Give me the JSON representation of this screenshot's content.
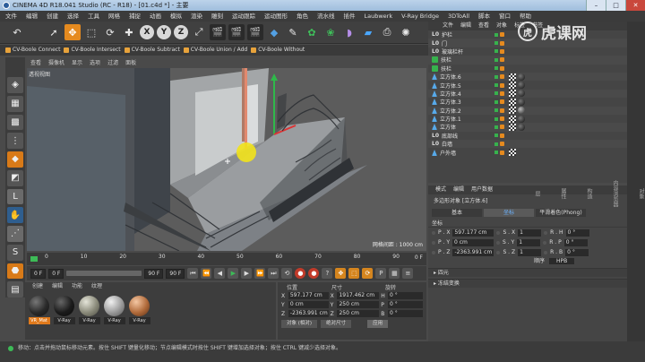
{
  "window": {
    "title": "CINEMA 4D R18.041 Studio (RC - R18) - [01.c4d *] - 主要",
    "min": "–",
    "max": "□",
    "close": "✕"
  },
  "menubar": [
    "文件",
    "编辑",
    "创建",
    "选择",
    "工具",
    "网格",
    "捕捉",
    "动画",
    "模拟",
    "渲染",
    "雕刻",
    "运动跟踪",
    "运动图形",
    "角色",
    "流水线",
    "插件",
    "Laubwerk",
    "V-Ray Bridge",
    "3DToAll",
    "脚本",
    "窗口",
    "帮助"
  ],
  "plugins": [
    "CV-Boole Connect",
    "CV-Boole Intersect",
    "CV-Boole Subtract",
    "CV-Boole Union / Add",
    "CV-Boole Without"
  ],
  "viewport": {
    "menu": [
      "查看",
      "摄像机",
      "显示",
      "选项",
      "过滤",
      "面板"
    ],
    "label": "透视视图",
    "grid_spacing": "网格间距 : 1000 cm"
  },
  "timeline": {
    "ticks": [
      "0",
      "10",
      "20",
      "30",
      "40",
      "50",
      "60",
      "70",
      "80",
      "90"
    ],
    "end": "0 F"
  },
  "frames": {
    "current": "0 F",
    "min": "0 F",
    "max": "90 F",
    "end": "90 F"
  },
  "materials": {
    "menu": [
      "创建",
      "编辑",
      "功能",
      "纹理"
    ],
    "items": [
      {
        "name": "VR_Mat",
        "color": "#2a2a2a"
      },
      {
        "name": "V-Ray",
        "color": "#1b1b1b"
      },
      {
        "name": "V-Ray",
        "color": "#8a8a7a"
      },
      {
        "name": "V-Ray",
        "color": "#9a9a9a"
      },
      {
        "name": "V-Ray",
        "color": "#b06a3a"
      }
    ]
  },
  "coords": {
    "headers": [
      "位置",
      "尺寸",
      "旋转"
    ],
    "rows": [
      {
        "axis": "X",
        "pos": "597.177 cm",
        "size": "1917.462 cm",
        "rot_axis": "H",
        "rot": "0 °"
      },
      {
        "axis": "Y",
        "pos": "0 cm",
        "size": "250 cm",
        "rot_axis": "P",
        "rot": "0 °"
      },
      {
        "axis": "Z",
        "pos": "-2363.991 cm",
        "size": "250 cm",
        "rot_axis": "B",
        "rot": "0 °"
      }
    ],
    "mode": "对象 (相对)",
    "size_mode": "绝对尺寸",
    "apply": "应用"
  },
  "objects": {
    "menu": [
      "文件",
      "编辑",
      "查看",
      "对象",
      "标签",
      "书签"
    ],
    "items": [
      {
        "name": "护栏",
        "icon": "l0"
      },
      {
        "name": "门",
        "icon": "l0"
      },
      {
        "name": "玻璃栏杆",
        "icon": "l0"
      },
      {
        "name": "扶栏",
        "icon": "green"
      },
      {
        "name": "扶栏",
        "icon": "green"
      },
      {
        "name": "立方体.6",
        "icon": "tri"
      },
      {
        "name": "立方体.5",
        "icon": "tri"
      },
      {
        "name": "立方体.4",
        "icon": "tri"
      },
      {
        "name": "立方体.3",
        "icon": "tri"
      },
      {
        "name": "立方体.2",
        "icon": "tri"
      },
      {
        "name": "立方体.1",
        "icon": "tri"
      },
      {
        "name": "立方体",
        "icon": "tri"
      },
      {
        "name": "底部线",
        "icon": "l0"
      },
      {
        "name": "白墙",
        "icon": "l0"
      },
      {
        "name": "户外墙",
        "icon": "tri"
      }
    ]
  },
  "attributes": {
    "menu": [
      "模式",
      "编辑",
      "用户数据"
    ],
    "title": "多边形对象 [立方体.6]",
    "tabs": [
      "基本",
      "坐标",
      "平滑着色(Phong)"
    ],
    "section": "坐标",
    "rows": [
      {
        "p": "P . X",
        "pv": "597.177 cm",
        "s": "S . X",
        "sv": "1",
        "r": "R . H",
        "rv": "0 °"
      },
      {
        "p": "P . Y",
        "pv": "0 cm",
        "s": "S . Y",
        "sv": "1",
        "r": "R . P",
        "rv": "0 °"
      },
      {
        "p": "P . Z",
        "pv": "-2363.991 cm",
        "s": "S . Z",
        "sv": "1",
        "r": "R . B",
        "rv": "0 °"
      }
    ],
    "order_label": "顺序",
    "order_value": "HPB",
    "folds": [
      "四元",
      "冻结变换"
    ]
  },
  "statusbar": "移动：点击并拖动鼠标移动元素。按住 SHIFT 键量化移动；节点编辑模式时按住 SHIFT 键增加选择对象；按住 CTRL 键减少选择对象。",
  "side_tabs": [
    "对象",
    "内容浏览器",
    "构造",
    "属性",
    "层"
  ],
  "watermark": "虎课网",
  "watermark_logo": "虎"
}
